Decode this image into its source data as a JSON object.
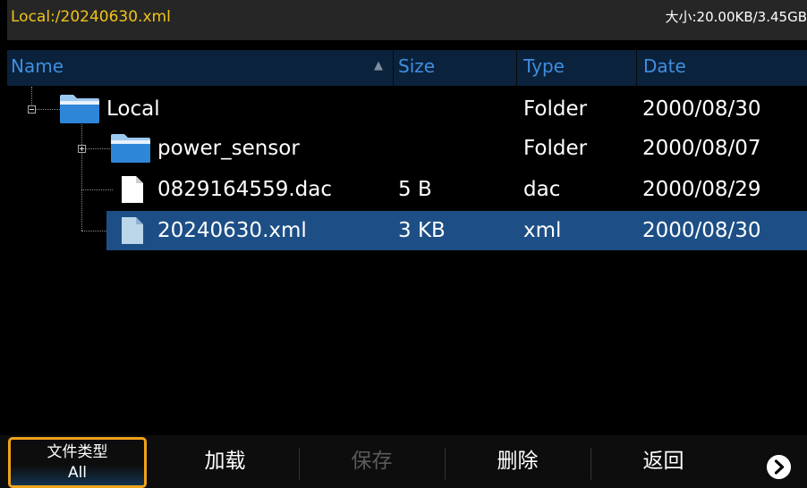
{
  "path_bar": {
    "path": "Local:/20240630.xml",
    "size_info": "大小:20.00KB/3.45GB"
  },
  "columns": {
    "name": "Name",
    "size": "Size",
    "type": "Type",
    "date": "Date"
  },
  "tree": {
    "root": {
      "name": "Local",
      "size": "",
      "type": "Folder",
      "date": "2000/08/30",
      "icon": "folder-icon",
      "expanded": true
    },
    "children": [
      {
        "name": "power_sensor",
        "size": "",
        "type": "Folder",
        "date": "2000/08/07",
        "icon": "folder-icon",
        "expanded": false
      },
      {
        "name": "0829164559.dac",
        "size": "5 B",
        "type": "dac",
        "date": "2000/08/29",
        "icon": "file-icon"
      },
      {
        "name": "20240630.xml",
        "size": "3 KB",
        "type": "xml",
        "date": "2000/08/30",
        "icon": "file-icon",
        "selected": true
      }
    ]
  },
  "softkeys": {
    "file_type": {
      "label": "文件类型",
      "value": "All"
    },
    "load": "加载",
    "save": "保存",
    "delete": "删除",
    "back": "返回",
    "next_icon": "chevron-right-circle-icon"
  },
  "colors": {
    "path_text": "#f0c419",
    "header_text": "#3f8ee0",
    "selected_row": "#1d4f86",
    "focus_border": "#f0a21a"
  }
}
